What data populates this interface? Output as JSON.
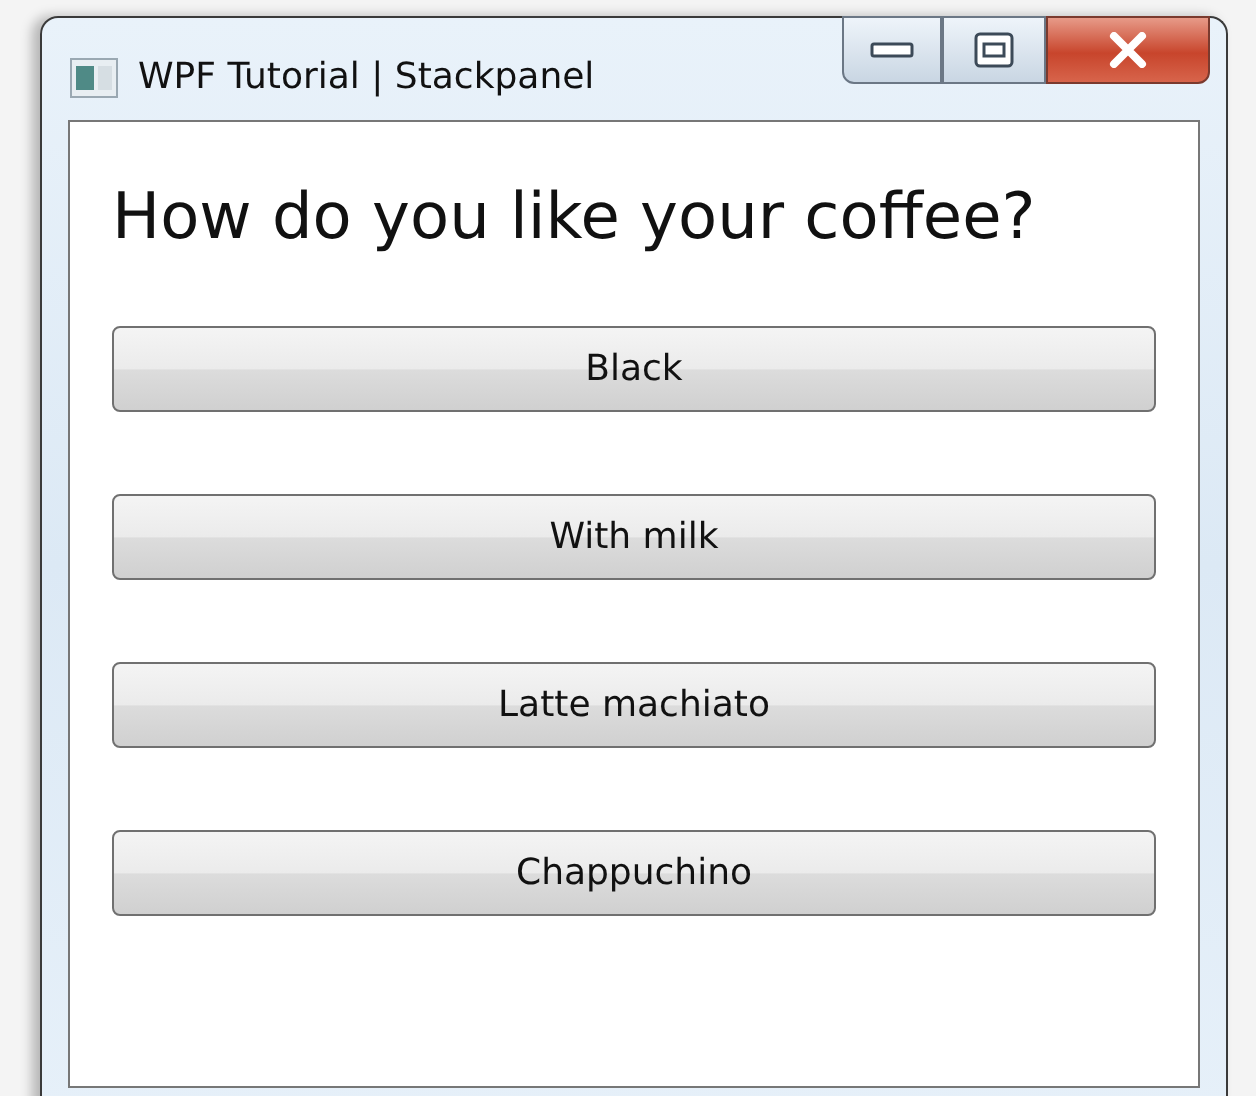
{
  "window": {
    "title": "WPF Tutorial | Stackpanel"
  },
  "heading": "How do you like your coffee?",
  "buttons": [
    {
      "label": "Black"
    },
    {
      "label": "With milk"
    },
    {
      "label": "Latte machiato"
    },
    {
      "label": "Chappuchino"
    }
  ]
}
